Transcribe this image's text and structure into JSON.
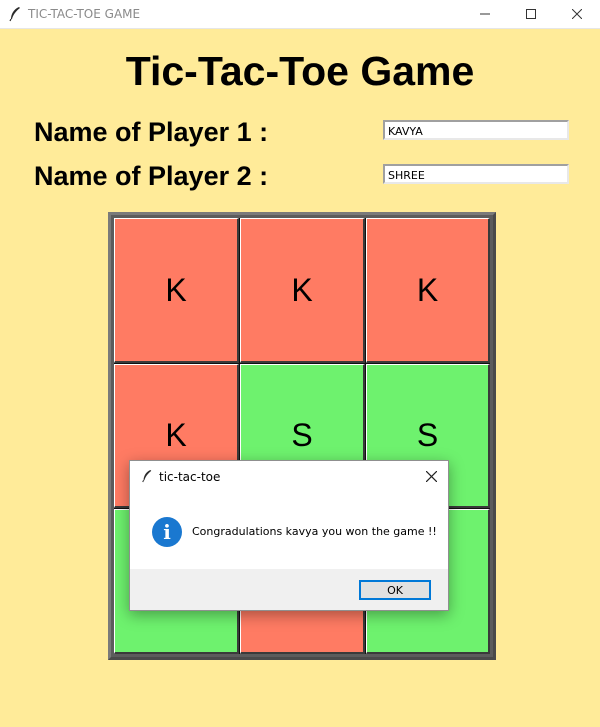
{
  "window": {
    "title": "TIC-TAC-TOE GAME",
    "icon": "feather-icon",
    "controls": [
      "minimize-icon",
      "maximize-icon",
      "close-icon"
    ]
  },
  "app": {
    "heading": "Tic-Tac-Toe Game",
    "player1": {
      "label": "Name of Player 1 :",
      "value": "KAVYA"
    },
    "player2": {
      "label": "Name of Player 2 :",
      "value": "SHREE"
    }
  },
  "board": {
    "cells": [
      "K",
      "K",
      "K",
      "K",
      "S",
      "S",
      "",
      "",
      ""
    ],
    "colors": {
      "K": "#ff7b63",
      "S": "#6ef26e"
    }
  },
  "dialog": {
    "title": "tic-tac-toe",
    "icon": "info-icon",
    "icon_glyph": "i",
    "message": "Congradulations kavya you won the game !!",
    "ok_label": "OK"
  },
  "colors": {
    "background": "#ffeb99",
    "accent": "#0078d7"
  }
}
